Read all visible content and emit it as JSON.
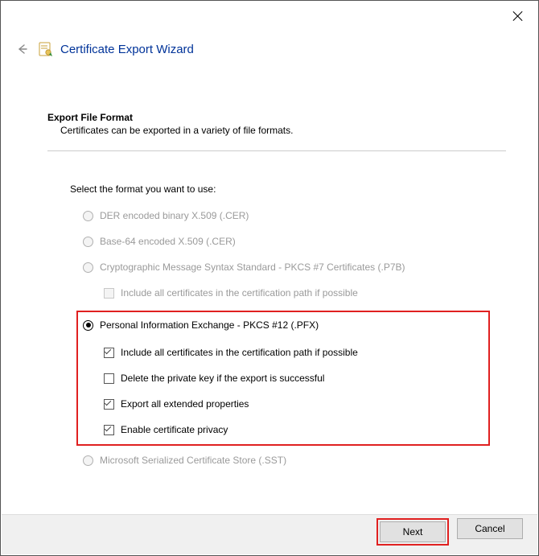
{
  "title": "Certificate Export Wizard",
  "section": {
    "heading": "Export File Format",
    "sub": "Certificates can be exported in a variety of file formats."
  },
  "select_label": "Select the format you want to use:",
  "options": {
    "der": {
      "label": "DER encoded binary X.509 (.CER)"
    },
    "b64": {
      "label": "Base-64 encoded X.509 (.CER)"
    },
    "p7b": {
      "label": "Cryptographic Message Syntax Standard - PKCS #7 Certificates (.P7B)"
    },
    "p7b_sub": {
      "label": "Include all certificates in the certification path if possible"
    },
    "pfx": {
      "label": "Personal Information Exchange - PKCS #12 (.PFX)"
    },
    "pfx_sub1": {
      "label": "Include all certificates in the certification path if possible"
    },
    "pfx_sub2": {
      "label": "Delete the private key if the export is successful"
    },
    "pfx_sub3": {
      "label": "Export all extended properties"
    },
    "pfx_sub4": {
      "label": "Enable certificate privacy"
    },
    "sst": {
      "label": "Microsoft Serialized Certificate Store (.SST)"
    }
  },
  "buttons": {
    "next": "Next",
    "cancel": "Cancel"
  }
}
